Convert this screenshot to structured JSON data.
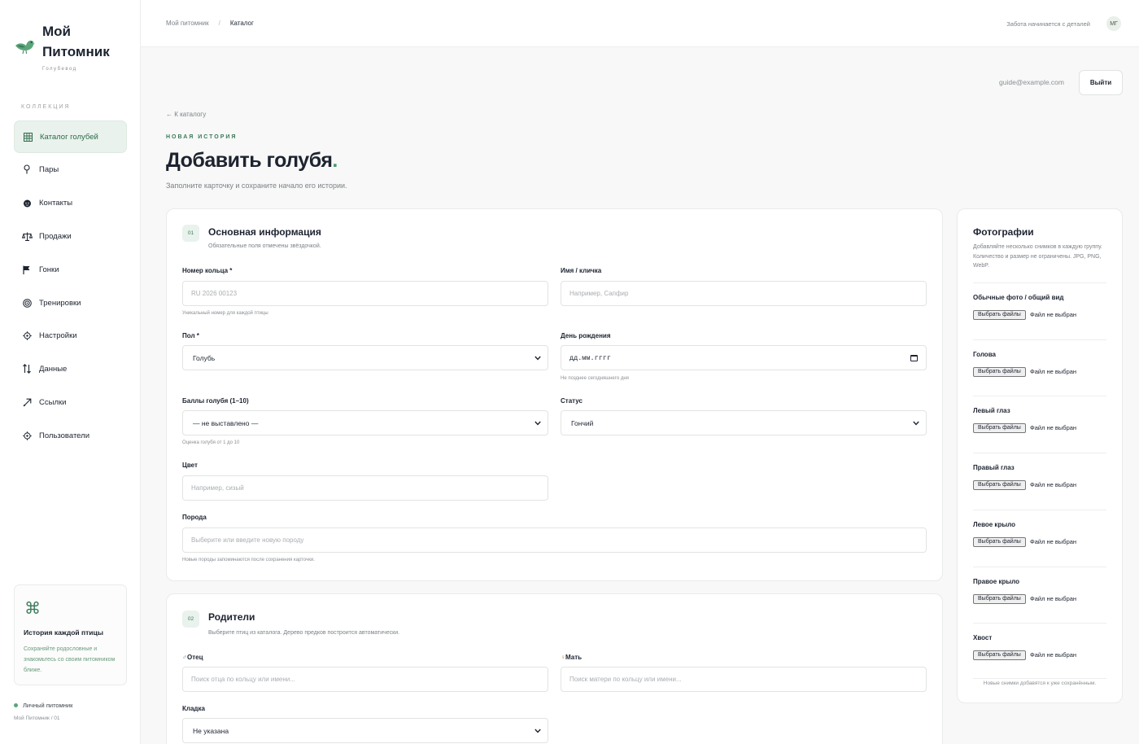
{
  "brand": {
    "name_line1": "Мой",
    "name_line2": "Питомник",
    "tagline": "Голубевод"
  },
  "sidebar": {
    "section_label": "КОЛЛЕКЦИЯ",
    "items": [
      {
        "label": "Каталог голубей",
        "icon": "grid-icon",
        "active": true
      },
      {
        "label": "Пары",
        "icon": "pin-icon"
      },
      {
        "label": "Контакты",
        "icon": "face-icon"
      },
      {
        "label": "Продажи",
        "icon": "scale-icon"
      },
      {
        "label": "Гонки",
        "icon": "flag-icon"
      },
      {
        "label": "Тренировки",
        "icon": "target-icon"
      },
      {
        "label": "Настройки",
        "icon": "gear-icon"
      },
      {
        "label": "Данные",
        "icon": "sort-arrows-icon"
      },
      {
        "label": "Ссылки",
        "icon": "link-arrow-icon"
      },
      {
        "label": "Пользователи",
        "icon": "users-icon"
      }
    ],
    "promo": {
      "symbol": "⌘",
      "title": "История каждой птицы",
      "description": "Сохраняйте родословные и знакомьтесь со своим питомником ближе."
    },
    "footer": {
      "label": "Личный питомник",
      "sub": "Мой Питомник / 01"
    }
  },
  "topbar": {
    "breadcrumb": {
      "root": "Мой питомник",
      "separator": "/",
      "current": "Каталог"
    },
    "motto": "Забота начинается с деталей",
    "avatar_initials": "МГ"
  },
  "account": {
    "email": "guide@example.com",
    "logout_label": "Выйти"
  },
  "page": {
    "back_link": "← К каталогу",
    "eyebrow": "НОВАЯ ИСТОРИЯ",
    "title": "Добавить голубя",
    "title_dot": ".",
    "subtitle": "Заполните карточку и сохраните начало его истории."
  },
  "basic": {
    "number": "01",
    "title": "Основная информация",
    "subtitle": "Обязательные поля отмечены звёздочкой.",
    "ring": {
      "label": "Номер кольца *",
      "placeholder": "RU 2026 00123",
      "hint": "Уникальный номер для каждой птицы"
    },
    "name": {
      "label": "Имя / кличка",
      "placeholder": "Например, Сапфир"
    },
    "sex": {
      "label": "Пол *",
      "value": "Голубь"
    },
    "birthday": {
      "label": "День рождения",
      "value": "дд.мм.гггг",
      "hint": "Не позднее сегодняшнего дня"
    },
    "score": {
      "label": "Баллы голубя (1–10)",
      "value": "— не выставлено —",
      "hint": "Оценка голубя от 1 до 10"
    },
    "status": {
      "label": "Статус",
      "value": "Гончий"
    },
    "color": {
      "label": "Цвет",
      "placeholder": "Например, сизый"
    },
    "breed": {
      "label": "Порода",
      "placeholder": "Выберите или введите новую породу",
      "hint": "Новые породы запоминаются после сохранения карточки."
    }
  },
  "parents": {
    "number": "02",
    "title": "Родители",
    "subtitle": "Выберите птиц из каталога. Дерево предков построится автоматически.",
    "father": {
      "symbol": "♂",
      "label": "Отец",
      "placeholder": "Поиск отца по кольцу или имени..."
    },
    "mother": {
      "symbol": "♀",
      "label": "Мать",
      "placeholder": "Поиск матери по кольцу или имени..."
    },
    "clutch": {
      "label": "Кладка",
      "value": "Не указана"
    }
  },
  "photos": {
    "title": "Фотографии",
    "description": "Добавляйте несколько снимков в каждую группу. Количество и размер не ограничены. JPG, PNG, WebP.",
    "button_label": "Выбрать файлы",
    "status_text": "Файл не выбран",
    "groups": [
      "Обычные фото / общий вид",
      "Голова",
      "Левый глаз",
      "Правый глаз",
      "Левое крыло",
      "Правое крыло",
      "Хвост"
    ],
    "footer": "Новые снимки добавятся к уже сохранённым."
  },
  "colors": {
    "accent": "#3b7a5a",
    "accent_bg": "#e9f2ec",
    "text": "#1d2330",
    "muted": "#7c8288"
  }
}
